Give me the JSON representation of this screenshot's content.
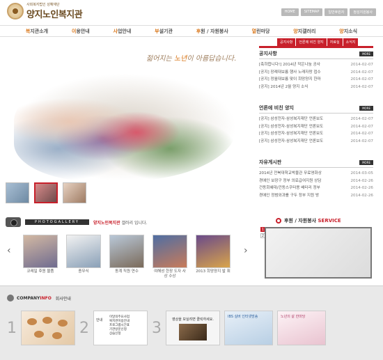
{
  "header": {
    "logo_sub": "사회복지법인 성혜재단",
    "logo_title": "양지노인복지관",
    "util": [
      "HOME",
      "SITEMAP",
      "일반후원자",
      "정성지원봉사"
    ]
  },
  "gnb": [
    {
      "first": "복",
      "rest": "지관소개"
    },
    {
      "first": "이",
      "rest": "용안내"
    },
    {
      "first": "사",
      "rest": "업안내"
    },
    {
      "first": "부",
      "rest": "설기관"
    },
    {
      "first": "후",
      "rest": "원 / 자원봉사"
    },
    {
      "first": "열",
      "rest": "린마당"
    },
    {
      "first": "양",
      "rest": "지갤러리"
    },
    {
      "first": "양",
      "rest": "지소식"
    }
  ],
  "subnav": [
    "공지사항",
    "언론에 비친 양지",
    "자료실",
    "소식지"
  ],
  "hero": {
    "slogan_pre": "젊어지는 ",
    "slogan_hl": "노년",
    "slogan_post": "이 아름답습니다."
  },
  "notices": {
    "title": "공지사항",
    "more": "MORE",
    "rows": [
      {
        "t": "[축하합니다!] 2014년 작은나눔 공사",
        "d": "2014-02-07"
      },
      {
        "t": "[공지] 장례대보름 행사 노래자랑 접수",
        "d": "2014-02-07"
      },
      {
        "t": "[공지] 정월대보름 맞이 희망양지 한마",
        "d": "2014-02-07"
      },
      {
        "t": "[공지] 2014년 2월 양지 소식",
        "d": "2014-02-07"
      }
    ]
  },
  "press": {
    "title": "언론에 비친 양지",
    "more": "MORE",
    "rows": [
      {
        "t": "[공지] 삼성전자-삼성복지재단 언론보도",
        "d": "2014-02-07"
      },
      {
        "t": "[공지] 삼성전자-삼성복지재단 언론보도",
        "d": "2014-02-07"
      },
      {
        "t": "[공지] 삼성전자-삼성복지재단 언론보도",
        "d": "2014-02-07"
      },
      {
        "t": "[공지] 삼성전자-삼성복지재단 언론보도",
        "d": "2014-02-07"
      }
    ]
  },
  "free": {
    "title": "자유게시판",
    "more": "MORE",
    "rows": [
      {
        "t": "2014년 전북대학교박물관 무료영화상",
        "d": "2014-03-05"
      },
      {
        "t": "경애인 보장구 정부 의료급여지원 상담",
        "d": "2014-02-26"
      },
      {
        "t": "건동회혜대/건동스쿠터용 배터리 정부",
        "d": "2014-02-26"
      },
      {
        "t": "경애인 정범와과를 구두 정부 지원 방",
        "d": "2014-02-26"
      }
    ]
  },
  "gallery": {
    "band": "PHOTOGALLERY",
    "desc_hl": "양지노인복지관",
    "desc_rest": " 갤러리 입니다.",
    "prev": "‹",
    "next": "›",
    "items": [
      {
        "cap": "코레일 후원 물품"
      },
      {
        "cap": "종무식"
      },
      {
        "cap": "동계 직원 연수"
      },
      {
        "cap": "여해성 한장 도자 사상 수상"
      },
      {
        "cap": "2013 희망양지 발 휘"
      }
    ]
  },
  "service": {
    "title_pre": "후원 / 자원봉사 ",
    "title_hl": "SERVICE",
    "nums": [
      "1",
      "2"
    ]
  },
  "company": {
    "en_pre": "COMPANY ",
    "en_hl": "INFO",
    "kr": "회사안내",
    "steps": [
      "1",
      "2",
      "3"
    ],
    "doc_side": "안내",
    "doc_lines": [
      "이달의주요사업",
      "복지관이용안내",
      "프로그램시간표",
      "기관방문신청",
      "상습신청"
    ],
    "video_text": "영상을 보실려면 클릭하세요.",
    "blue_text": "IBS 실버 인터넷방송",
    "pink_text": "노년의 삶 한마당"
  }
}
